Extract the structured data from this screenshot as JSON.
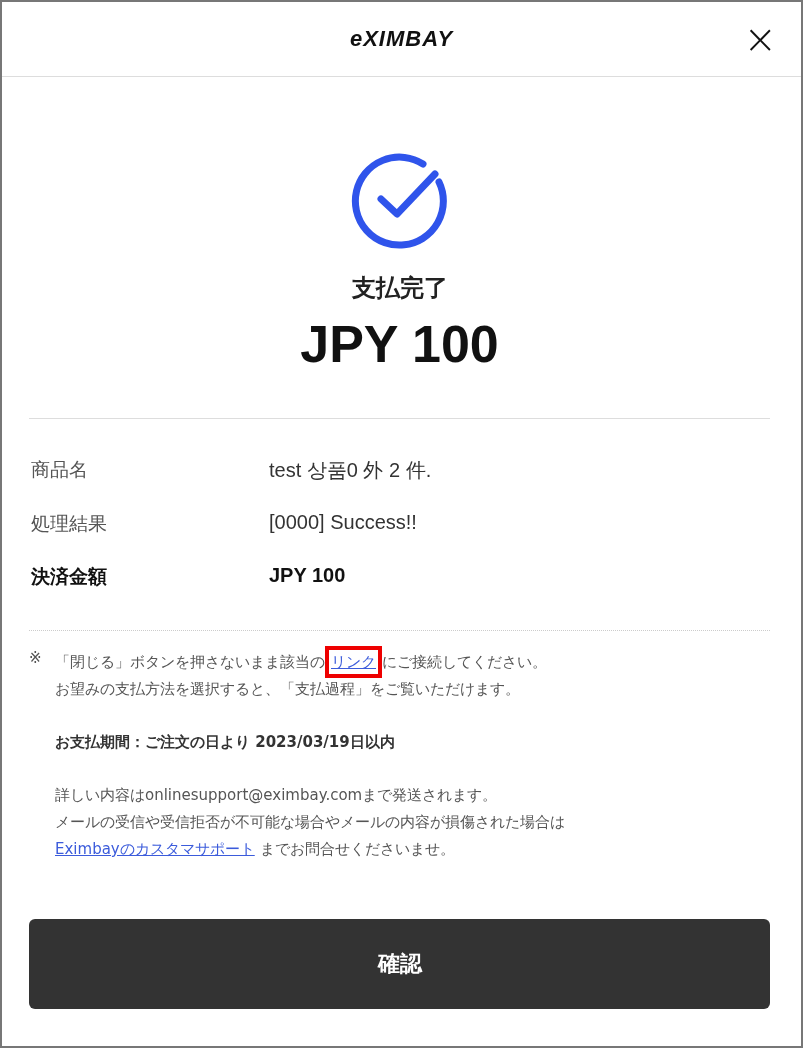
{
  "header": {
    "logo": "eXIMBAY",
    "close": "×"
  },
  "status": {
    "title": "支払完了",
    "amount": "JPY 100"
  },
  "details": [
    {
      "label": "商品名",
      "value": "test 상품0 外 2 件.",
      "emphasis": false
    },
    {
      "label": "処理結果",
      "value": "[0000] Success!!",
      "emphasis": false
    },
    {
      "label": "決済金額",
      "value": "JPY 100",
      "emphasis": true
    }
  ],
  "notice": {
    "mark": "※",
    "before": "「閉じる」ボタンを押さないまま該当の",
    "link": "リンク",
    "link_highlighted": true,
    "after": "にご接続してください。",
    "line2": "お望みの支払方法を選択すると、「支払過程」をご覧いただけます。"
  },
  "period": "お支払期間：ご注文の日より 2023/03/19日以内",
  "contact": {
    "line1": "詳しい内容はonlinesupport@eximbay.comまで発送されます。",
    "line2": "メールの受信や受信拒否が不可能な場合やメールの内容が損傷された場合は",
    "link": "Eximbayのカスタマサポート",
    "after": " までお問合せくださいませ。"
  },
  "confirm_button": "確認"
}
